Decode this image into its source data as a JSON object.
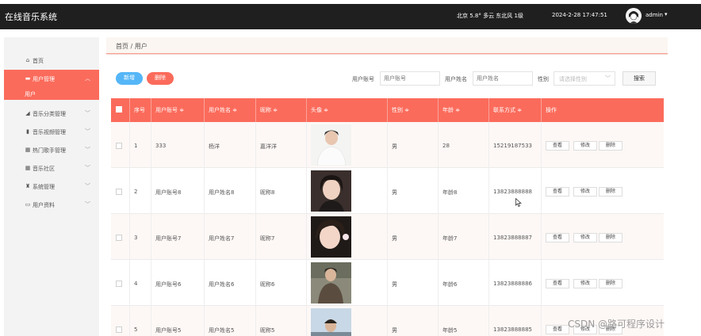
{
  "header": {
    "app_title": "在线音乐系统",
    "weather": "北京  5.8°  多云  东北风  1级",
    "datetime": "2024-2-28 17:47:51",
    "user": "admin",
    "caret": "▾"
  },
  "sidebar": {
    "items": [
      {
        "label": "首页",
        "icon": "home-icon",
        "glyph": "⌂"
      },
      {
        "label": "用户管理",
        "icon": "user-manage-icon",
        "glyph": "▬"
      },
      {
        "label": "音乐分类管理",
        "icon": "category-icon",
        "glyph": "◢"
      },
      {
        "label": "音乐视频管理",
        "icon": "bar-chart-icon",
        "glyph": "▮"
      },
      {
        "label": "热门歌手管理",
        "icon": "grid-icon",
        "glyph": "▦"
      },
      {
        "label": "音乐社区",
        "icon": "grid-icon",
        "glyph": "▦"
      },
      {
        "label": "系统管理",
        "icon": "trophy-icon",
        "glyph": "♜"
      },
      {
        "label": "用户资料",
        "icon": "profile-card-icon",
        "glyph": "▭"
      }
    ],
    "sub_active": "用户",
    "chevron_up": "︿",
    "chevron_down": "﹀"
  },
  "breadcrumb": "首页 / 用户",
  "actions": {
    "add": "新增",
    "delete": "删除"
  },
  "search": {
    "account_label": "用户账号",
    "account_placeholder": "用户账号",
    "name_label": "用户姓名",
    "name_placeholder": "用户姓名",
    "gender_label": "性别",
    "gender_placeholder": "请选择性别",
    "button": "搜索"
  },
  "table": {
    "columns": [
      "序号",
      "用户账号 ≑",
      "用户姓名 ≑",
      "昵称 ≑",
      "头像 ≑",
      "性别 ≑",
      "年龄 ≑",
      "联系方式 ≑",
      "操作"
    ],
    "rows": [
      {
        "index": "1",
        "account": "333",
        "name": "杨洋",
        "nickname": "嘉洋洋",
        "gender": "男",
        "age": "28",
        "phone": "15219187533"
      },
      {
        "index": "2",
        "account": "用户账号8",
        "name": "用户姓名8",
        "nickname": "昵称8",
        "gender": "男",
        "age": "年龄8",
        "phone": "13823888888"
      },
      {
        "index": "3",
        "account": "用户账号7",
        "name": "用户姓名7",
        "nickname": "昵称7",
        "gender": "男",
        "age": "年龄7",
        "phone": "13823888887"
      },
      {
        "index": "4",
        "account": "用户账号6",
        "name": "用户姓名6",
        "nickname": "昵称6",
        "gender": "男",
        "age": "年龄6",
        "phone": "13823888886"
      },
      {
        "index": "5",
        "account": "用户账号5",
        "name": "用户姓名5",
        "nickname": "昵称5",
        "gender": "男",
        "age": "年龄5",
        "phone": "13823888885"
      }
    ],
    "ops": {
      "view": "查看",
      "edit": "修改",
      "delete": "删除"
    }
  },
  "watermark": "CSDN @路可程序设计",
  "colors": {
    "accent": "#fb6b5b",
    "primary_btn": "#55b6f7",
    "topbar": "#1f1f1f"
  }
}
